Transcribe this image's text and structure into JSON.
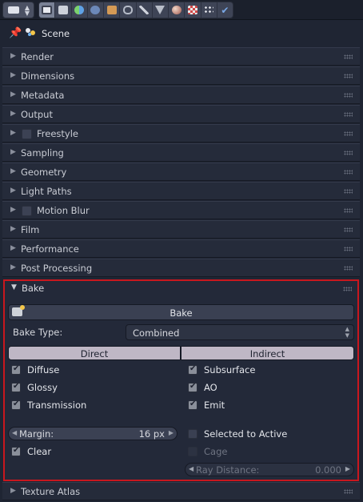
{
  "header": {
    "scene_label": "Scene"
  },
  "context_tabs": [
    {
      "icon": "render-icon"
    },
    {
      "icon": "render-layers-icon"
    },
    {
      "icon": "scene-icon"
    },
    {
      "icon": "world-icon"
    },
    {
      "icon": "object-icon"
    },
    {
      "icon": "constraints-icon"
    },
    {
      "icon": "modifiers-icon"
    },
    {
      "icon": "data-icon"
    },
    {
      "icon": "material-icon"
    },
    {
      "icon": "texture-icon"
    },
    {
      "icon": "particles-icon"
    },
    {
      "icon": "physics-icon"
    }
  ],
  "panels": [
    {
      "label": "Render"
    },
    {
      "label": "Dimensions"
    },
    {
      "label": "Metadata"
    },
    {
      "label": "Output"
    },
    {
      "label": "Freestyle"
    },
    {
      "label": "Sampling"
    },
    {
      "label": "Geometry"
    },
    {
      "label": "Light Paths"
    },
    {
      "label": "Motion Blur"
    },
    {
      "label": "Film"
    },
    {
      "label": "Performance"
    },
    {
      "label": "Post Processing"
    }
  ],
  "bake": {
    "title": "Bake",
    "bake_button": "Bake",
    "type_label": "Bake Type:",
    "type_value": "Combined",
    "direct_label": "Direct",
    "indirect_label": "Indirect",
    "left_options": [
      {
        "label": "Diffuse",
        "checked": true
      },
      {
        "label": "Glossy",
        "checked": true
      },
      {
        "label": "Transmission",
        "checked": true
      }
    ],
    "right_options": [
      {
        "label": "Subsurface",
        "checked": true
      },
      {
        "label": "AO",
        "checked": true
      },
      {
        "label": "Emit",
        "checked": true
      }
    ],
    "margin_label": "Margin:",
    "margin_value": "16 px",
    "clear_label": "Clear",
    "selected_to_active_label": "Selected to Active",
    "cage_label": "Cage",
    "ray_distance_label": "Ray Distance:",
    "ray_distance_value": "0.000"
  },
  "texture_atlas": {
    "label": "Texture Atlas"
  },
  "colors": {
    "highlight_border": "#c8171e",
    "segment_bg": "#bfb7c5"
  }
}
